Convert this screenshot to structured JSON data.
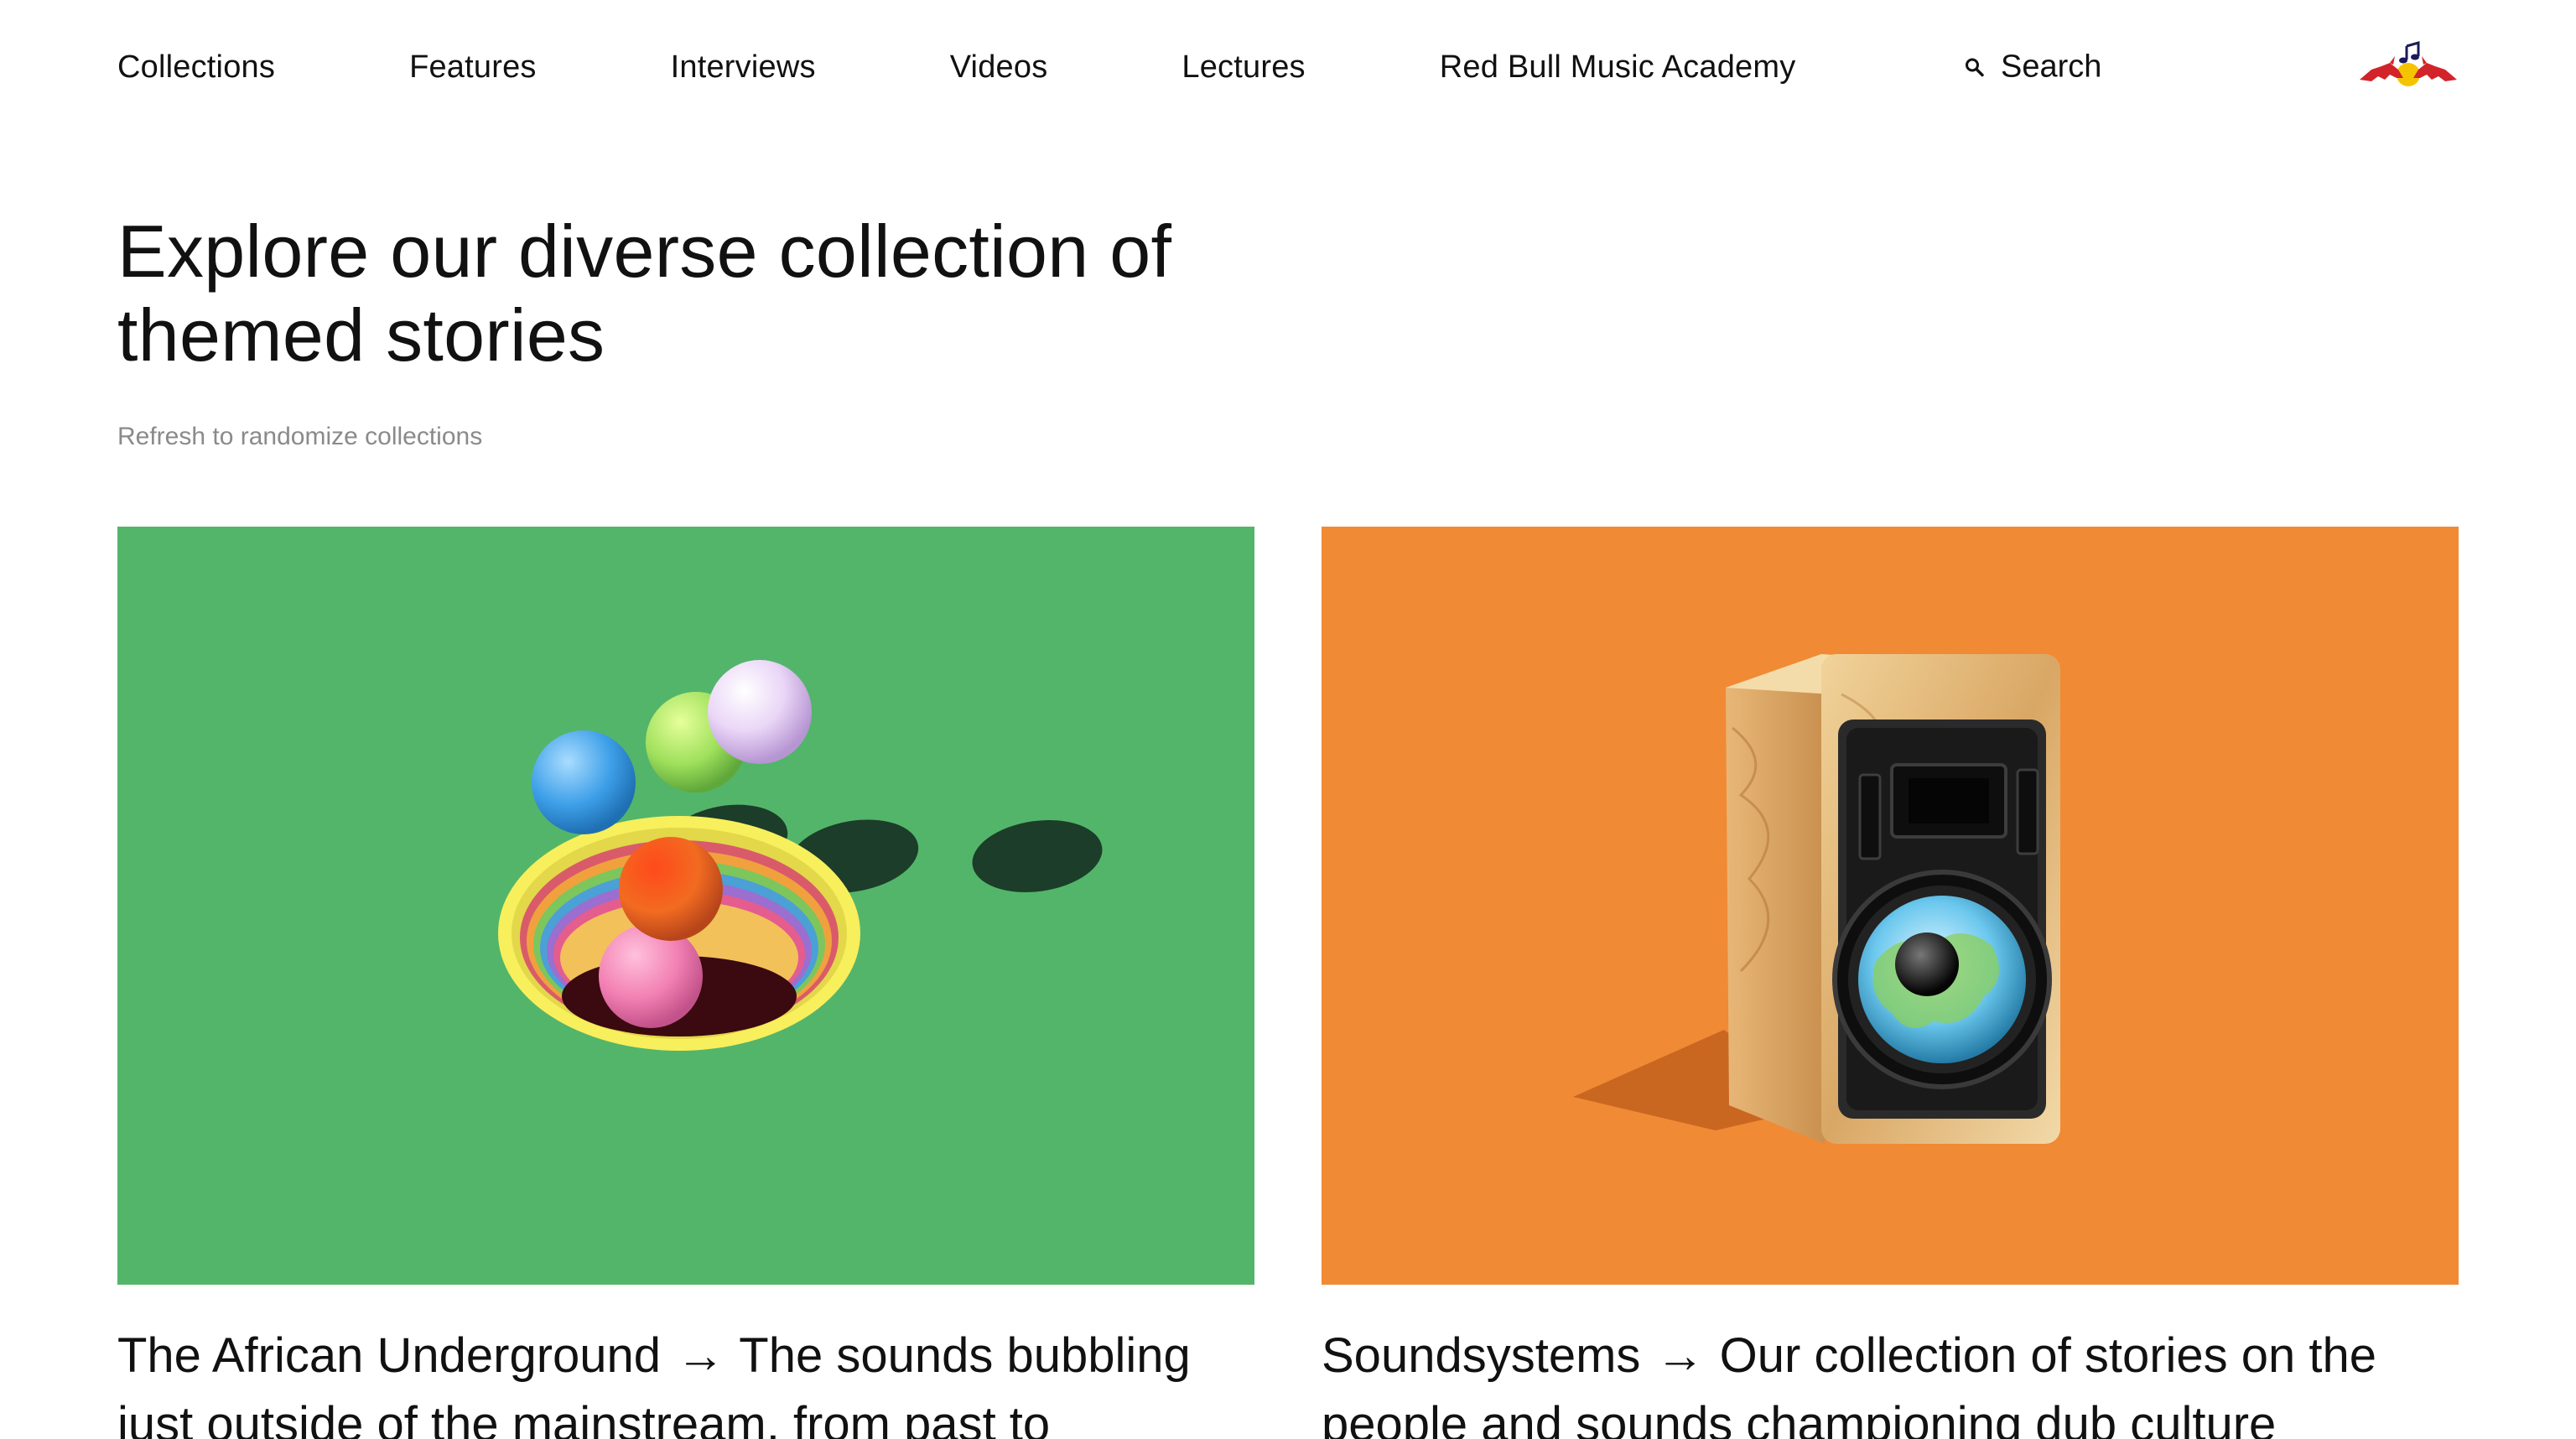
{
  "nav": {
    "items": [
      {
        "label": "Collections"
      },
      {
        "label": "Features"
      },
      {
        "label": "Interviews"
      },
      {
        "label": "Videos"
      },
      {
        "label": "Lectures"
      },
      {
        "label": "Red Bull Music Academy"
      }
    ],
    "search_label": "Search",
    "search_icon": "search-icon",
    "logo_icon": "red-bull-logo"
  },
  "hero": {
    "title": "Explore our diverse collection of themed stories",
    "subtitle": "Refresh to randomize collections"
  },
  "cards": [
    {
      "title": "The African Underground",
      "arrow": "→",
      "description": "The sounds bubbling just outside of the mainstream, from past to",
      "bg_color": "#53b56a",
      "image_icon": "colorful-balls-in-hole-illustration"
    },
    {
      "title": "Soundsystems",
      "arrow": "→",
      "description": "Our collection of stories on the people and sounds championing dub culture",
      "bg_color": "#f08a35",
      "image_icon": "wooden-speaker-illustration"
    }
  ]
}
